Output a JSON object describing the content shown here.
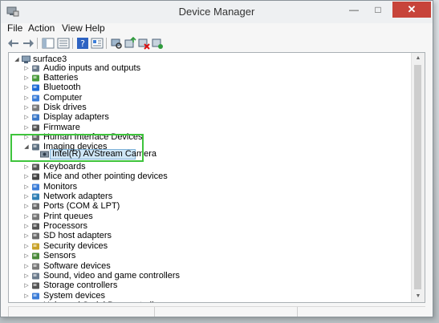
{
  "window": {
    "title": "Device Manager"
  },
  "menu": {
    "items": [
      "File",
      "Action",
      "View",
      "Help"
    ]
  },
  "tree": {
    "root": "surface3",
    "categories": [
      {
        "label": "Audio inputs and outputs",
        "icon": "speaker-icon",
        "color": "#6b7b8c"
      },
      {
        "label": "Batteries",
        "icon": "battery-icon",
        "color": "#4a9b3c"
      },
      {
        "label": "Bluetooth",
        "icon": "bluetooth-icon",
        "color": "#1e6bd6"
      },
      {
        "label": "Computer",
        "icon": "computer-icon",
        "color": "#3b7dd8"
      },
      {
        "label": "Disk drives",
        "icon": "disk-drive-icon",
        "color": "#7a7a7a"
      },
      {
        "label": "Display adapters",
        "icon": "display-adapter-icon",
        "color": "#3a78c8"
      },
      {
        "label": "Firmware",
        "icon": "firmware-icon",
        "color": "#555555"
      },
      {
        "label": "Human Interface Devices",
        "icon": "hid-icon",
        "color": "#6b6b6b"
      },
      {
        "label": "Imaging devices",
        "icon": "camera-icon",
        "color": "#5c6f80",
        "expanded": true
      },
      {
        "label": "Keyboards",
        "icon": "keyboard-icon",
        "color": "#555555"
      },
      {
        "label": "Mice and other pointing devices",
        "icon": "mouse-icon",
        "color": "#444444"
      },
      {
        "label": "Monitors",
        "icon": "monitor-icon",
        "color": "#3b7dd8"
      },
      {
        "label": "Network adapters",
        "icon": "network-adapter-icon",
        "color": "#2f7fb5"
      },
      {
        "label": "Ports (COM & LPT)",
        "icon": "port-icon",
        "color": "#6b6b6b"
      },
      {
        "label": "Print queues",
        "icon": "printer-icon",
        "color": "#777777"
      },
      {
        "label": "Processors",
        "icon": "processor-icon",
        "color": "#555555"
      },
      {
        "label": "SD host adapters",
        "icon": "sd-card-icon",
        "color": "#6b6b6b"
      },
      {
        "label": "Security devices",
        "icon": "security-icon",
        "color": "#c9a227"
      },
      {
        "label": "Sensors",
        "icon": "sensor-icon",
        "color": "#4a8a3a"
      },
      {
        "label": "Software devices",
        "icon": "software-device-icon",
        "color": "#7a7a7a"
      },
      {
        "label": "Sound, video and game controllers",
        "icon": "sound-icon",
        "color": "#6b7b8c"
      },
      {
        "label": "Storage controllers",
        "icon": "storage-controller-icon",
        "color": "#555555"
      },
      {
        "label": "System devices",
        "icon": "system-device-icon",
        "color": "#3b7dd8"
      },
      {
        "label": "Universal Serial Bus controllers",
        "icon": "usb-icon",
        "color": "#555555"
      }
    ],
    "selected_child": "Intel(R) AVStream Camera"
  },
  "colors": {
    "highlight": "#3ec43c",
    "selection": "#cfe6f6",
    "close": "#c7443a"
  }
}
